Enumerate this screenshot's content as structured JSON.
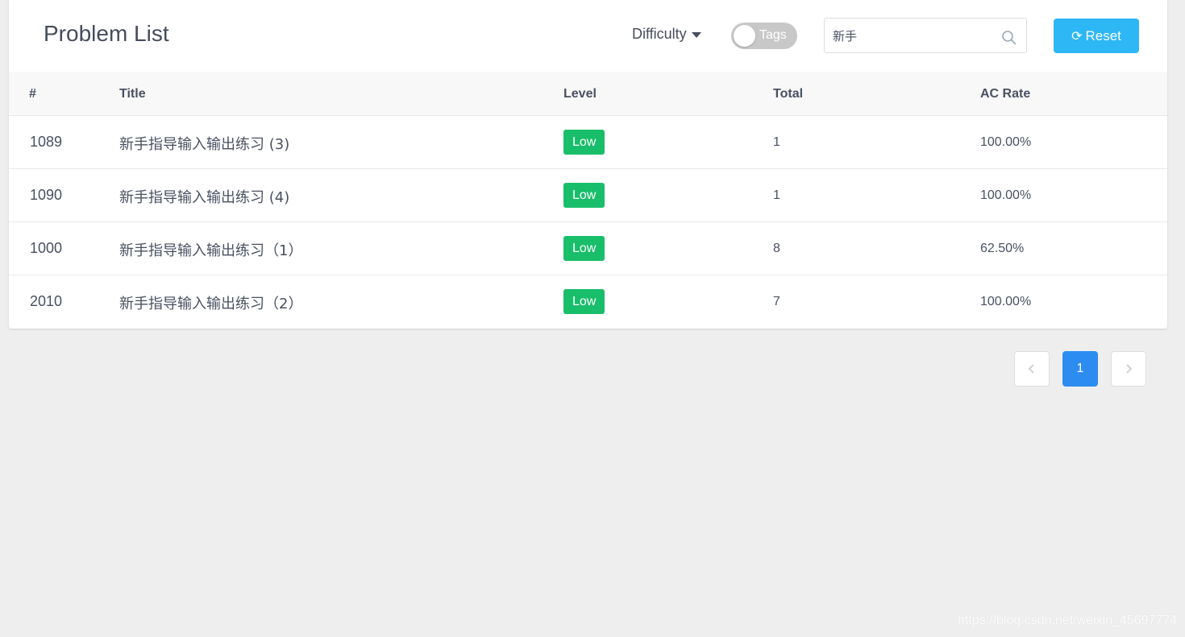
{
  "header": {
    "title": "Problem List",
    "difficulty_label": "Difficulty",
    "tags_label": "Tags",
    "tags_enabled": false,
    "search_value": "新手",
    "reset_label": "Reset"
  },
  "table": {
    "columns": [
      "#",
      "Title",
      "Level",
      "Total",
      "AC Rate"
    ],
    "rows": [
      {
        "id": "1089",
        "title": "新手指导输入输出练习 (3)",
        "level": "Low",
        "total": "1",
        "ac_rate": "100.00%"
      },
      {
        "id": "1090",
        "title": "新手指导输入输出练习 (4)",
        "level": "Low",
        "total": "1",
        "ac_rate": "100.00%"
      },
      {
        "id": "1000",
        "title": "新手指导输入输出练习（1）",
        "level": "Low",
        "total": "8",
        "ac_rate": "62.50%"
      },
      {
        "id": "2010",
        "title": "新手指导输入输出练习（2）",
        "level": "Low",
        "total": "7",
        "ac_rate": "100.00%"
      }
    ]
  },
  "pagination": {
    "prev_icon": "chevron-left-icon",
    "next_icon": "chevron-right-icon",
    "current_page": "1"
  },
  "watermark": "https://blog.csdn.net/weixin_45697774",
  "colors": {
    "accent_blue": "#2db7f5",
    "active_page": "#2d8cf0",
    "level_low": "#19be6b",
    "toggle_off": "#c8c8c8"
  }
}
